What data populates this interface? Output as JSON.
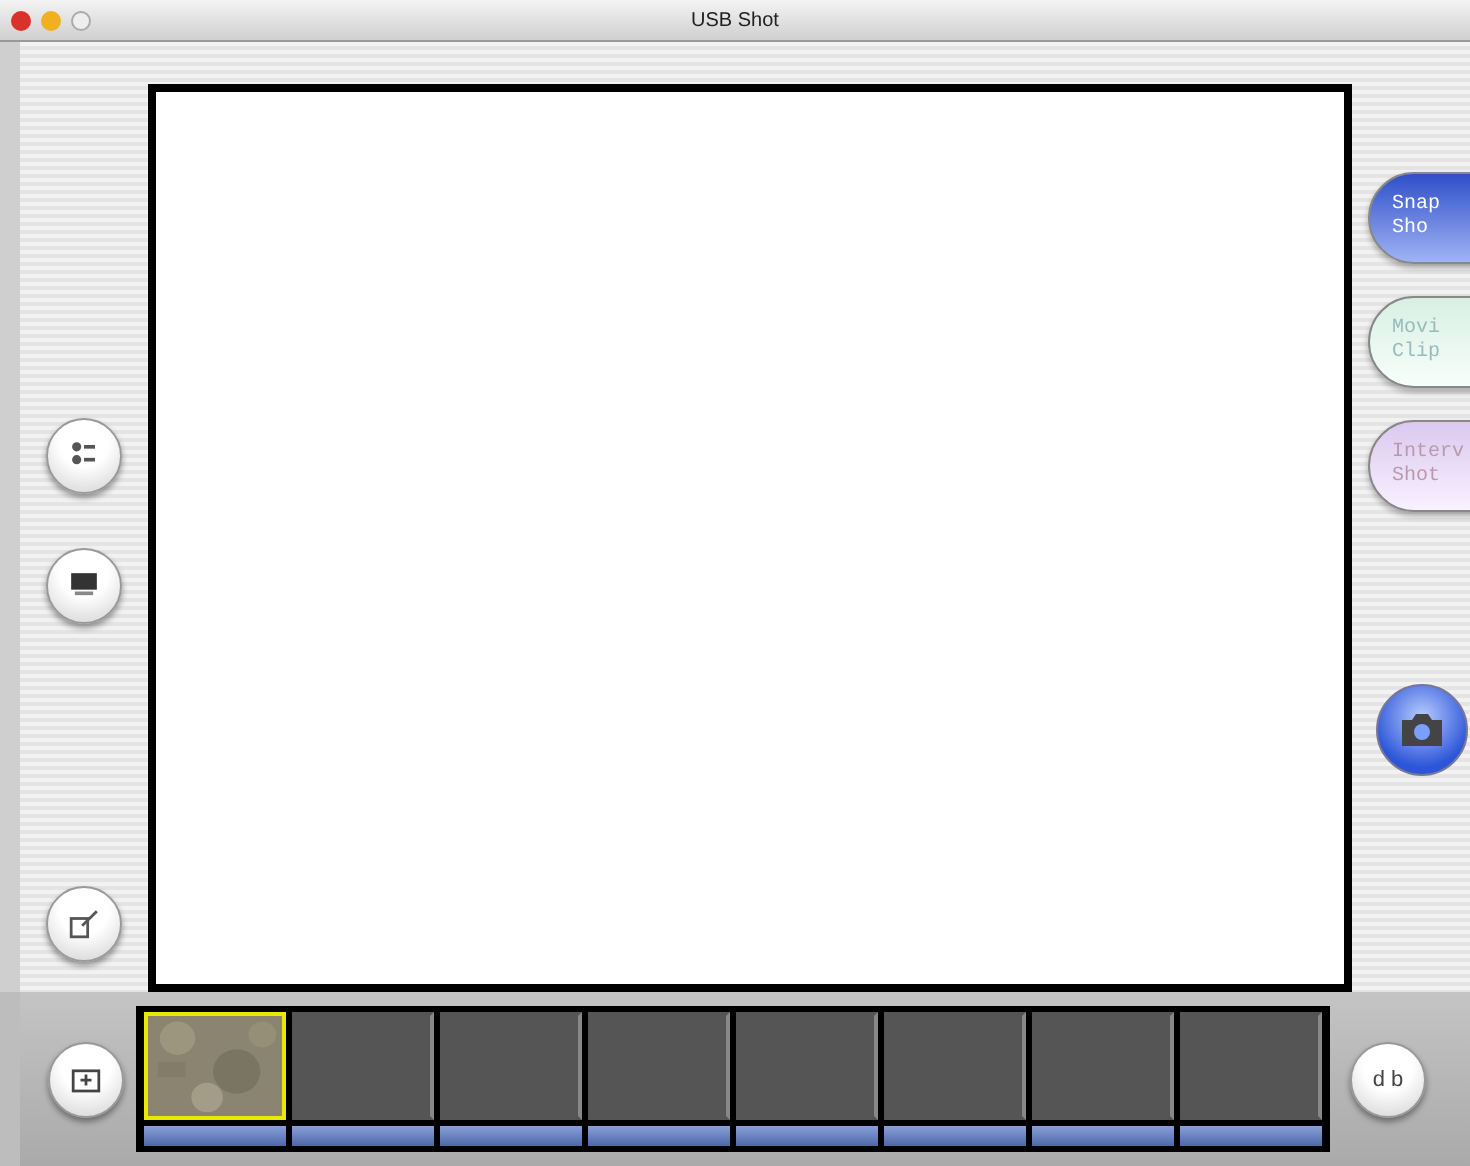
{
  "window": {
    "title": "USB Shot"
  },
  "mode_buttons": [
    {
      "lines": [
        "Snap",
        "Sho"
      ],
      "selected": true
    },
    {
      "lines": [
        "Movi",
        "Clip"
      ],
      "selected": false
    },
    {
      "lines": [
        "Interv",
        "Shot"
      ],
      "selected": false
    }
  ],
  "bottom_right_button": {
    "label": "d b"
  },
  "filmstrip": [
    {
      "kind": "picture",
      "selected": true
    },
    {
      "kind": "empty",
      "selected": false
    },
    {
      "kind": "empty",
      "selected": false
    },
    {
      "kind": "empty",
      "selected": false
    },
    {
      "kind": "empty",
      "selected": false
    },
    {
      "kind": "empty",
      "selected": false
    },
    {
      "kind": "empty",
      "selected": false
    },
    {
      "kind": "empty",
      "selected": false
    }
  ]
}
